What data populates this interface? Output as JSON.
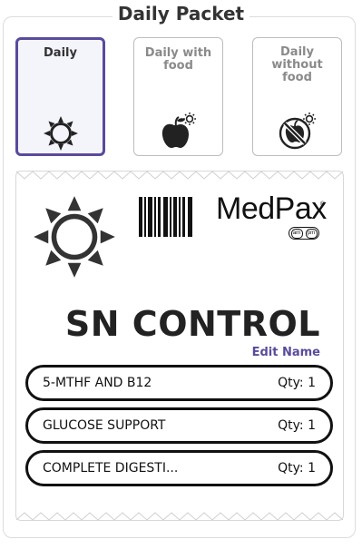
{
  "header": {
    "title": "Daily Packet"
  },
  "options": [
    {
      "label": "Daily"
    },
    {
      "label": "Daily with food"
    },
    {
      "label": "Daily without food"
    }
  ],
  "packet": {
    "brand": "MedPax",
    "brand_mark": "®",
    "am_label": "am",
    "pm_label": "pm",
    "name": "SN CONTROL",
    "edit_label": "Edit Name",
    "items": [
      {
        "name": "5-MTHF AND B12",
        "qty": "Qty: 1"
      },
      {
        "name": "GLUCOSE SUPPORT",
        "qty": "Qty: 1"
      },
      {
        "name": "COMPLETE DIGESTI...",
        "qty": "Qty: 1"
      }
    ]
  },
  "colors": {
    "accent": "#5a4a9c",
    "selected_bg": "#f4f4fb",
    "text_dark": "#222222"
  },
  "icons": [
    "sun-icon",
    "apple-sun-icon",
    "no-food-icon",
    "barcode-icon"
  ]
}
